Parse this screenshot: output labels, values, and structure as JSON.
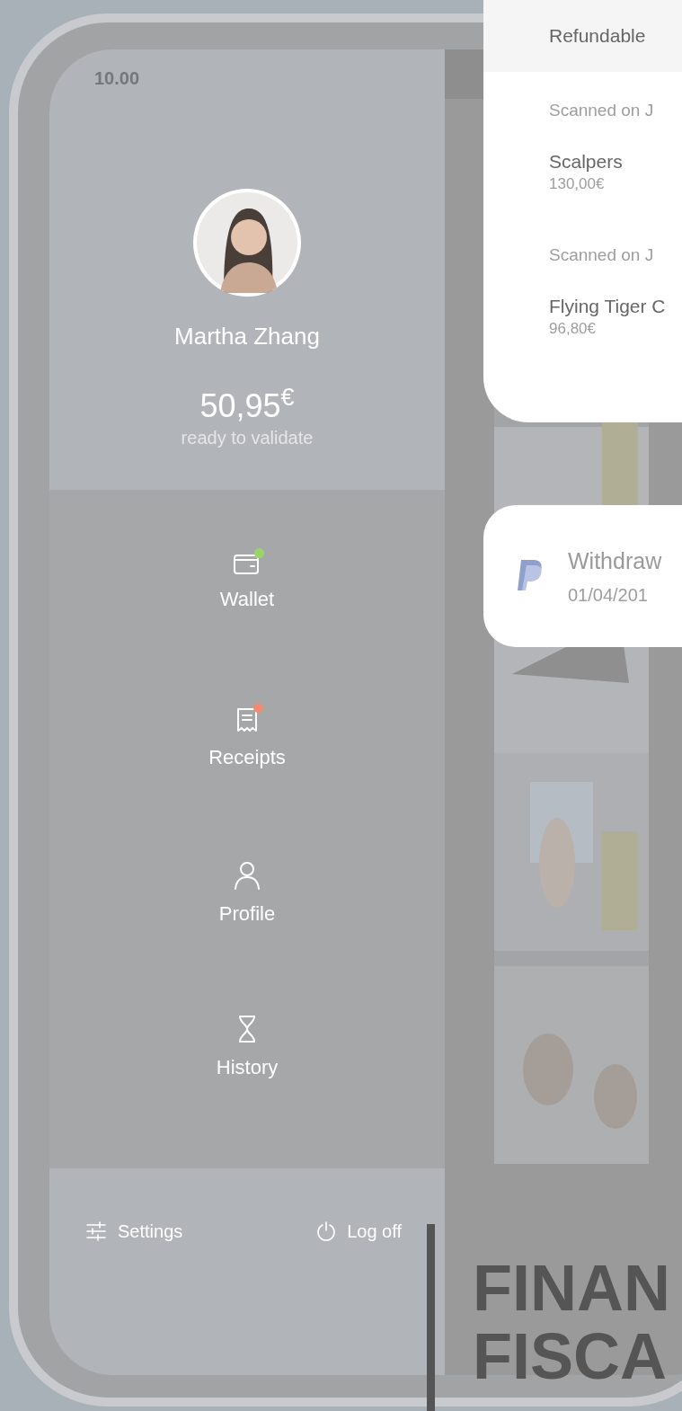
{
  "status_bar": {
    "time": "10.00"
  },
  "profile": {
    "name": "Martha Zhang",
    "balance": "50,95$^{€}$",
    "balance_caption": "ready to validate"
  },
  "menu": [
    {
      "label": "Wallet",
      "kind": "wallet",
      "color": "#9bd46c"
    },
    {
      "label": "Receipts",
      "kind": "receipt",
      "color": "#f08c73"
    },
    {
      "label": "Profile",
      "kind": "user"
    },
    {
      "label": "History",
      "kind": "hourglass"
    }
  ],
  "footer": [
    {
      "label": "Settings",
      "kind": "sliders"
    },
    {
      "label": "Log off",
      "kind": "power"
    }
  ],
  "refund_card": {
    "header": "Refundable",
    "items": [
      {
        "scanned": "Scanned on J",
        "store": "Scalpers",
        "amount": "130,00€"
      },
      {
        "scanned": "Scanned on J",
        "store": "Flying Tiger C",
        "amount": "96,80€"
      }
    ]
  },
  "withdraw_card": {
    "title": "Withdraw",
    "date": "01/04/201"
  },
  "headline": [
    "FINAN",
    "FISCA"
  ]
}
